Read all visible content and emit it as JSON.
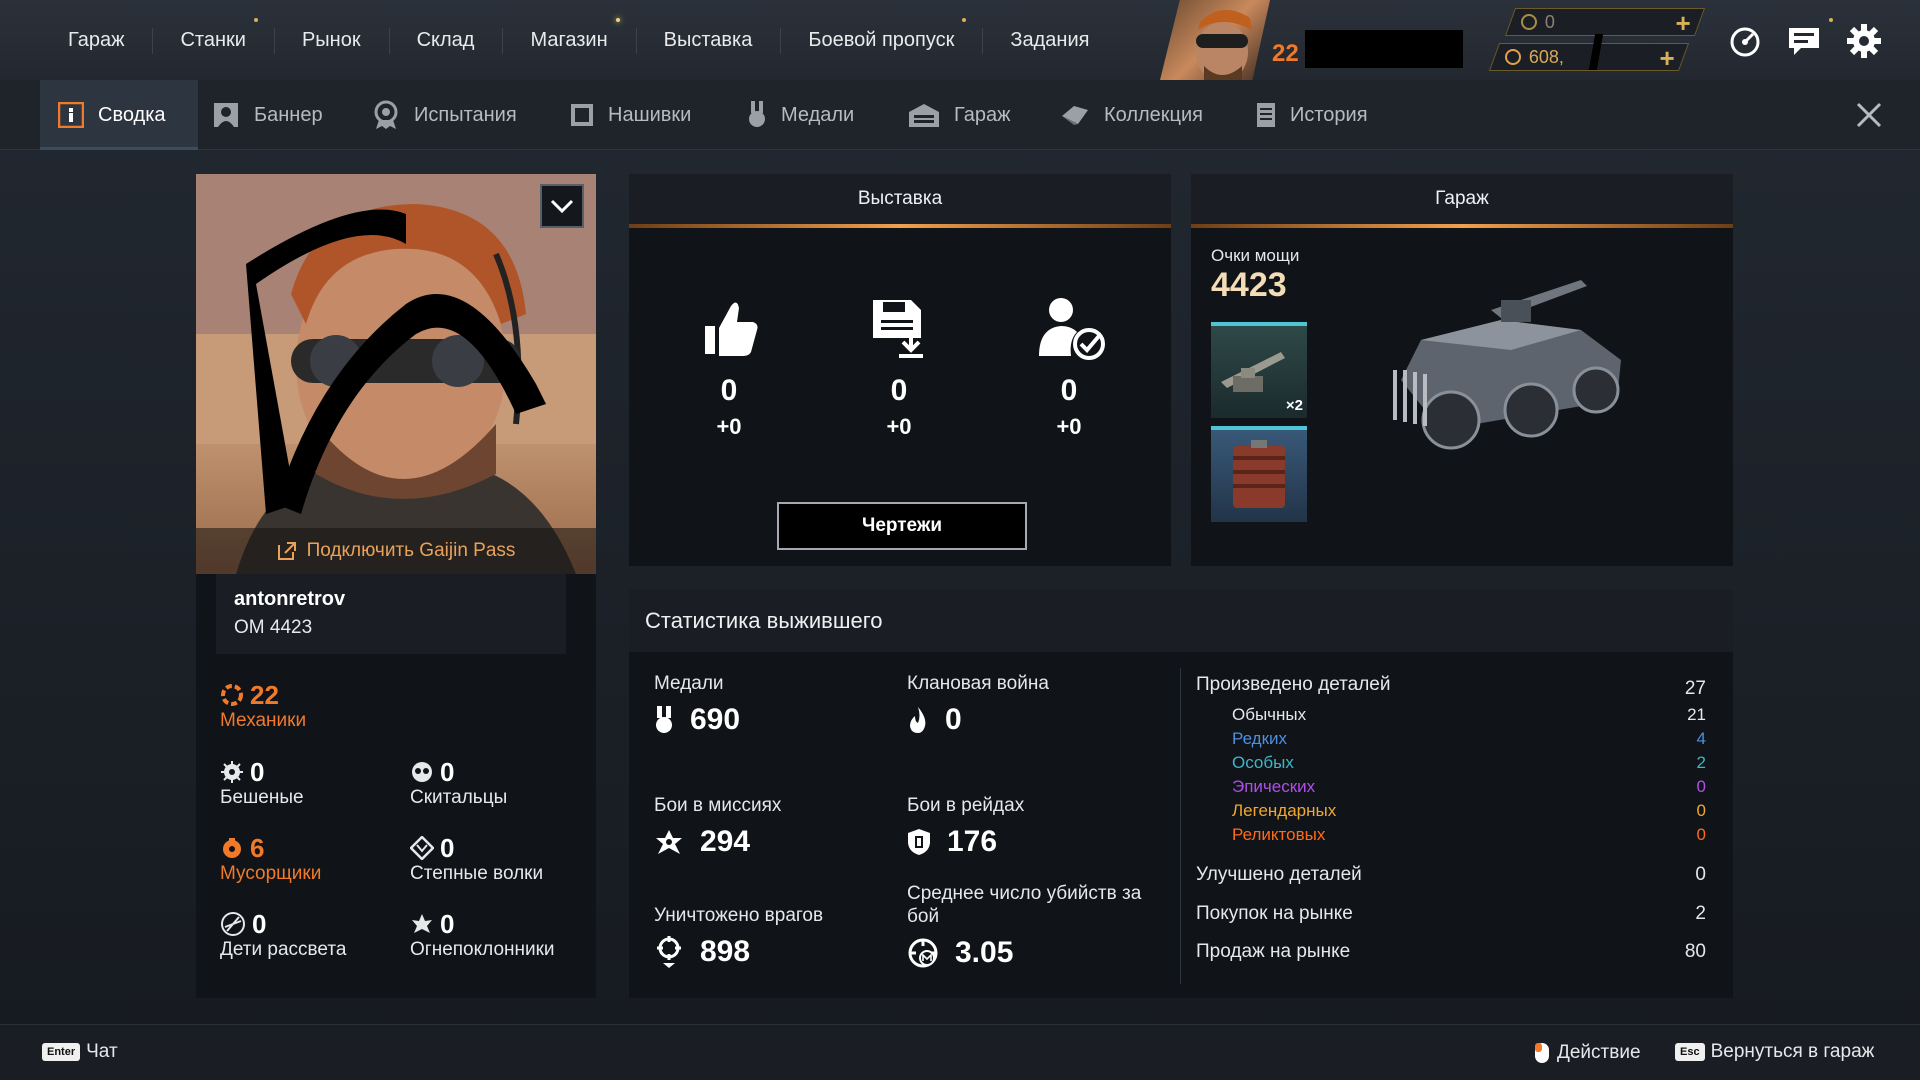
{
  "top_nav": [
    {
      "label": "Гараж",
      "dot": false
    },
    {
      "label": "Станки",
      "dot": true
    },
    {
      "label": "Рынок",
      "dot": false
    },
    {
      "label": "Склад",
      "dot": false
    },
    {
      "label": "Магазин",
      "dot": true
    },
    {
      "label": "Выставка",
      "dot": false
    },
    {
      "label": "Боевой пропуск",
      "dot": true
    },
    {
      "label": "Задания",
      "dot": false
    }
  ],
  "player_level": "22",
  "currency": {
    "coins": "0",
    "silver": "608,"
  },
  "tabs": [
    "Сводка",
    "Баннер",
    "Испытания",
    "Нашивки",
    "Медали",
    "Гараж",
    "Коллекция",
    "История"
  ],
  "profile": {
    "gaijin_link": "Подключить Gaijin Pass",
    "username": "antonretrov",
    "om": "ОМ 4423",
    "factions": {
      "mechanics": {
        "value": "22",
        "label": "Механики"
      },
      "lunatics": {
        "value": "0",
        "label": "Бешеные"
      },
      "nomads": {
        "value": "0",
        "label": "Скитальцы"
      },
      "scavengers": {
        "value": "6",
        "label": "Мусорщики"
      },
      "steppenwolfs": {
        "value": "0",
        "label": "Степные волки"
      },
      "dawns_children": {
        "value": "0",
        "label": "Дети рассвета"
      },
      "firestarters": {
        "value": "0",
        "label": "Огнепоклонники"
      }
    }
  },
  "exhibition": {
    "title": "Выставка",
    "stats": [
      {
        "icon": "thumbs-up-icon",
        "value": "0",
        "delta": "+0"
      },
      {
        "icon": "save-download-icon",
        "value": "0",
        "delta": "+0"
      },
      {
        "icon": "user-check-icon",
        "value": "0",
        "delta": "+0"
      }
    ],
    "blueprints_button": "Чертежи"
  },
  "garage": {
    "title": "Гараж",
    "power_label": "Очки мощи",
    "power_value": "4423",
    "items": [
      {
        "badge": "×2",
        "kind": "cannon"
      },
      {
        "badge": "",
        "kind": "ammo-pack"
      }
    ]
  },
  "stats": {
    "title": "Статистика выжившего",
    "medals": {
      "label": "Медали",
      "value": "690"
    },
    "clan_war": {
      "label": "Клановая война",
      "value": "0"
    },
    "mission_battles": {
      "label": "Бои в миссиях",
      "value": "294"
    },
    "raid_battles": {
      "label": "Бои в рейдах",
      "value": "176"
    },
    "enemies_destroyed": {
      "label": "Уничтожено врагов",
      "value": "898"
    },
    "avg_kills": {
      "label": "Среднее число убийств за бой",
      "value": "3.05"
    },
    "produced": {
      "label": "Произведено деталей",
      "value": "27"
    },
    "rarity": [
      {
        "label": "Обычных",
        "value": "21",
        "color": "#e6e8ea"
      },
      {
        "label": "Редких",
        "value": "4",
        "color": "#4d8fe0"
      },
      {
        "label": "Особых",
        "value": "2",
        "color": "#3fb6c8"
      },
      {
        "label": "Эпических",
        "value": "0",
        "color": "#b04fe8"
      },
      {
        "label": "Легендарных",
        "value": "0",
        "color": "#f0a830"
      },
      {
        "label": "Реликтовых",
        "value": "0",
        "color": "#ff6a1a"
      }
    ],
    "upgraded": {
      "label": "Улучшено деталей",
      "value": "0"
    },
    "market_buys": {
      "label": "Покупок на рынке",
      "value": "2"
    },
    "market_sales": {
      "label": "Продаж на рынке",
      "value": "80"
    }
  },
  "footer": {
    "chat_key": "Enter",
    "chat": "Чат",
    "action": "Действие",
    "esc_key": "Esc",
    "back": "Вернуться в гараж"
  },
  "colors": {
    "accent_orange": "#f07a2a",
    "gold": "#d7b058",
    "panel": "#101317"
  }
}
